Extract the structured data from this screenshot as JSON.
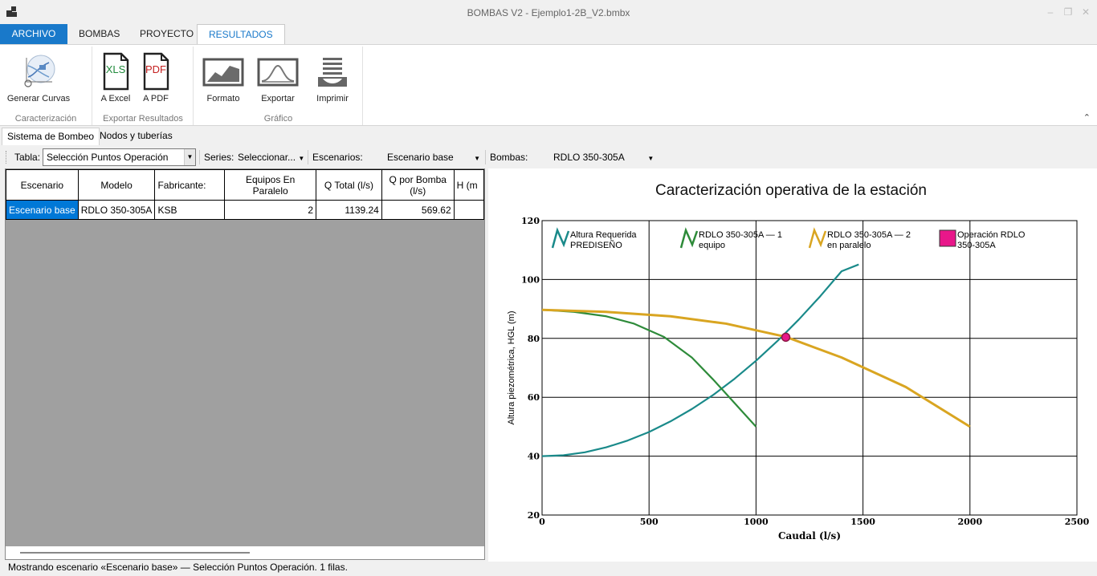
{
  "window": {
    "title": "BOMBAS V2 - Ejemplo1-2B_V2.bmbx"
  },
  "menu": {
    "tabs": [
      "ARCHIVO",
      "BOMBAS",
      "PROYECTO",
      "RESULTADOS"
    ],
    "active": "RESULTADOS"
  },
  "ribbon": {
    "groups": [
      {
        "label": "Caracterización",
        "buttons": [
          {
            "label": "Generar Curvas",
            "icon": "curve-generator-icon"
          }
        ]
      },
      {
        "label": "Exportar Resultados",
        "buttons": [
          {
            "label": "A Excel",
            "icon_text": "XLS",
            "icon": "excel-file-icon"
          },
          {
            "label": "A PDF",
            "icon_text": "PDF",
            "icon": "pdf-file-icon"
          }
        ]
      },
      {
        "label": "Gráfico",
        "buttons": [
          {
            "label": "Formato",
            "icon": "format-chart-icon"
          },
          {
            "label": "Exportar",
            "icon": "export-chart-icon"
          },
          {
            "label": "Imprimir",
            "icon": "print-icon"
          }
        ]
      }
    ]
  },
  "section_tabs": [
    "Sistema de Bombeo",
    "Nodos y tuberías"
  ],
  "toolbar": {
    "tabla_label": "Tabla:",
    "tabla_value": "Selección Puntos Operación",
    "series_label": "Series:",
    "series_value": "Seleccionar...",
    "escenarios_label": "Escenarios:",
    "escenarios_value": "Escenario base",
    "bombas_label": "Bombas:",
    "bombas_value": "RDLO 350-305A"
  },
  "table": {
    "columns": [
      "Escenario",
      "Modelo",
      "Fabricante:",
      "Equipos En Paralelo",
      "Q Total (l/s)",
      "Q por Bomba (l/s)",
      "H (m"
    ],
    "rows": [
      [
        "Escenario base",
        "RDLO 350-305A",
        "KSB",
        "2",
        "1139.24",
        "569.62",
        ""
      ]
    ]
  },
  "status": {
    "text": "Mostrando escenario «Escenario base» — Selección Puntos Operación. 1 filas."
  },
  "colors": {
    "accent": "#1979ca",
    "selection": "#0078d7",
    "required": "#1a8a8a",
    "one_pump": "#2e8b3a",
    "parallel": "#d9a521",
    "operation": "#e8178a"
  },
  "chart_data": {
    "type": "line",
    "title": "Caracterización operativa de la estación",
    "xlabel": "Caudal (l/s)",
    "ylabel": "Altura piezométrica, HGL (m)",
    "xlim": [
      0,
      2500
    ],
    "ylim": [
      20,
      120
    ],
    "xticks": [
      0,
      500,
      1000,
      1500,
      2000,
      2500
    ],
    "yticks": [
      20,
      40,
      60,
      80,
      100,
      120
    ],
    "grid": true,
    "legend_position": "top",
    "series": [
      {
        "name": "Altura Requerida PREDISEÑO",
        "color": "#1a8a8a",
        "x": [
          0,
          100,
          200,
          300,
          400,
          500,
          600,
          700,
          800,
          900,
          1000,
          1100,
          1200,
          1300,
          1400,
          1480
        ],
        "y": [
          40,
          40.3,
          41.3,
          43,
          45.3,
          48.2,
          51.8,
          56,
          60.8,
          66.3,
          72.4,
          79.1,
          86.4,
          94.3,
          102.8,
          105.1
        ]
      },
      {
        "name": "RDLO 350-305A — 1 equipo",
        "color": "#2e8b3a",
        "x": [
          0,
          150,
          300,
          430,
          570,
          700,
          800,
          900,
          1000
        ],
        "y": [
          89.7,
          89,
          87.5,
          85,
          80.5,
          73.5,
          66,
          58,
          50
        ]
      },
      {
        "name": "RDLO 350-305A — 2 en paralelo",
        "color": "#d9a521",
        "x": [
          0,
          300,
          600,
          860,
          1140,
          1400,
          1700,
          2000
        ],
        "y": [
          89.7,
          89,
          87.5,
          85,
          80.5,
          73.5,
          63.5,
          50
        ]
      },
      {
        "name": "Operación RDLO 350-305A",
        "color": "#e8178a",
        "type": "scatter",
        "x": [
          1139.24
        ],
        "y": [
          80.4
        ]
      }
    ]
  }
}
